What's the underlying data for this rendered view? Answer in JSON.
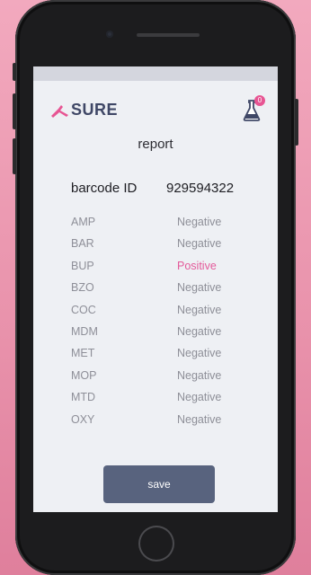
{
  "brand": {
    "name": "SURE",
    "accent": "#e75593",
    "dark": "#3f4766"
  },
  "header": {
    "badge_count": "0",
    "flask_icon": "flask-icon"
  },
  "page": {
    "title": "report"
  },
  "barcode": {
    "label": "barcode ID",
    "value": "929594322"
  },
  "results": [
    {
      "name": "AMP",
      "value": "Negative",
      "positive": false
    },
    {
      "name": "BAR",
      "value": "Negative",
      "positive": false
    },
    {
      "name": "BUP",
      "value": "Positive",
      "positive": true
    },
    {
      "name": "BZO",
      "value": "Negative",
      "positive": false
    },
    {
      "name": "COC",
      "value": "Negative",
      "positive": false
    },
    {
      "name": "MDM",
      "value": "Negative",
      "positive": false
    },
    {
      "name": "MET",
      "value": "Negative",
      "positive": false
    },
    {
      "name": "MOP",
      "value": "Negative",
      "positive": false
    },
    {
      "name": "MTD",
      "value": "Negative",
      "positive": false
    },
    {
      "name": "OXY",
      "value": "Negative",
      "positive": false
    }
  ],
  "actions": {
    "save_label": "save"
  }
}
